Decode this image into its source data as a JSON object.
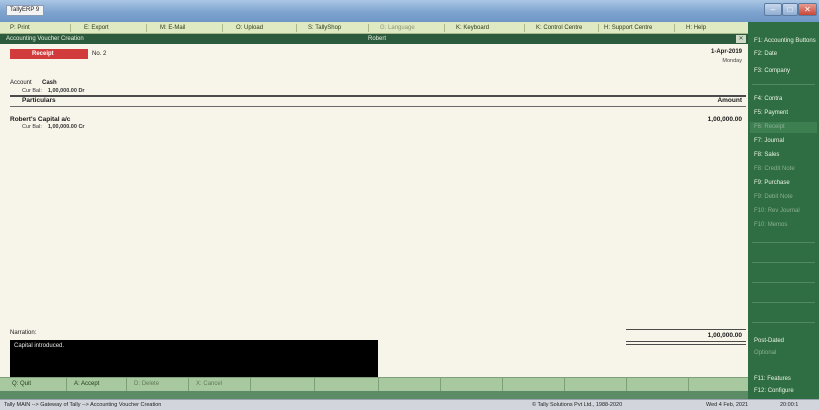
{
  "window": {
    "title": "TallyERP 9"
  },
  "top_menu": [
    {
      "key": "P",
      "label": "Print",
      "enabled": true
    },
    {
      "key": "E",
      "label": "Export",
      "enabled": true
    },
    {
      "key": "M",
      "label": "E-Mail",
      "enabled": true
    },
    {
      "key": "O",
      "label": "Upload",
      "enabled": true
    },
    {
      "key": "S",
      "label": "TallyShop",
      "enabled": true
    },
    {
      "key": "G",
      "label": "Language",
      "enabled": false
    },
    {
      "key": "K",
      "label": "Keyboard",
      "enabled": true
    },
    {
      "key": "K",
      "label": "Control Centre",
      "enabled": true
    },
    {
      "key": "H",
      "label": "Support Centre",
      "enabled": true
    },
    {
      "key": "H",
      "label": "Help",
      "enabled": true
    }
  ],
  "header": {
    "title": "Accounting Voucher Creation",
    "company": "Robert",
    "close_label": "Ctrl + M"
  },
  "voucher": {
    "type": "Receipt",
    "number": "No. 2",
    "date": "1-Apr-2019",
    "day": "Monday",
    "account_label": "Account",
    "account_value": "Cash",
    "account_balance_label": "Cur Bal:",
    "account_balance": "1,00,000.00 Dr",
    "columns": {
      "particulars": "Particulars",
      "amount": "Amount"
    },
    "entries": [
      {
        "ledger": "Robert's Capital a/c",
        "balance_label": "Cur Bal:",
        "balance": "1,00,000.00 Cr",
        "amount": "1,00,000.00"
      }
    ],
    "narration_label": "Narration:",
    "narration": "Capital introduced.",
    "total": "1,00,000.00"
  },
  "bottom_buttons": [
    {
      "key": "Q",
      "label": "Quit",
      "enabled": true
    },
    {
      "key": "A",
      "label": "Accept",
      "enabled": true
    },
    {
      "key": "D",
      "label": "Delete",
      "enabled": false
    },
    {
      "key": "X",
      "label": "Cancel",
      "enabled": false
    }
  ],
  "right_panel": [
    {
      "key": "F1",
      "label": "Accounting Buttons",
      "enabled": true
    },
    {
      "key": "F2",
      "label": "Date",
      "enabled": true
    },
    {
      "key": "F3",
      "label": "Company",
      "enabled": true
    },
    {
      "key": "F4",
      "label": "Contra",
      "enabled": true
    },
    {
      "key": "F5",
      "label": "Payment",
      "enabled": true
    },
    {
      "key": "F6",
      "label": "Receipt",
      "enabled": false
    },
    {
      "key": "F7",
      "label": "Journal",
      "enabled": true
    },
    {
      "key": "F8",
      "label": "Sales",
      "enabled": true
    },
    {
      "key": "F8",
      "label": "Credit Note",
      "enabled": false
    },
    {
      "key": "F9",
      "label": "Purchase",
      "enabled": true
    },
    {
      "key": "F9",
      "label": "Debit Note",
      "enabled": false
    },
    {
      "key": "F10",
      "label": "Rev Journal",
      "enabled": false
    },
    {
      "key": "F10",
      "label": "Memos",
      "enabled": false
    },
    {
      "key": "",
      "label": "Post-Dated",
      "enabled": true
    },
    {
      "key": "",
      "label": "Optional",
      "enabled": false
    },
    {
      "key": "F11",
      "label": "Features",
      "enabled": true
    },
    {
      "key": "F12",
      "label": "Configure",
      "enabled": true
    }
  ],
  "status_bar": {
    "left": "Tally MAIN --> Gateway of Tally --> Accounting Voucher Creation",
    "center": "© Tally Solutions Pvt Ltd., 1988-2020",
    "date": "Wed 4 Feb, 2021",
    "time": "20:00:1"
  },
  "colors": {
    "voucher_bg": "#f7f4ea",
    "voucher_type_badge": "#d23b3b",
    "header_bar": "#2c5a3c",
    "right_panel": "#2f6d42",
    "top_menu": "#dfe9c2",
    "bottom_bar": "#a8c9a0"
  }
}
